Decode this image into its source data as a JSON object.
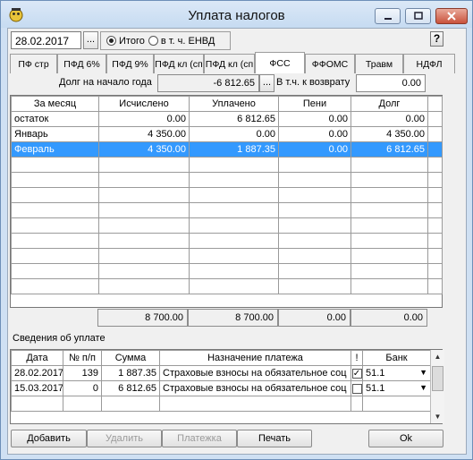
{
  "window": {
    "title": "Уплата налогов"
  },
  "toolbar": {
    "date": "28.02.2017",
    "dots": "...",
    "radio_total": "Итого",
    "radio_envd": "в т. ч. ЕНВД",
    "help": "?"
  },
  "tabs": [
    "ПФ стр",
    "ПФД 6%",
    "ПФД 9%",
    "ПФД кл (сп",
    "ПФД кл (сп",
    "ФСС",
    "ФФОМС",
    "Травм",
    "НДФЛ"
  ],
  "active_tab": "ФСС",
  "debt_info": {
    "debt_label": "Долг на начало года",
    "debt_value": "-6 812.65",
    "refund_label": "В т.ч. к возврату",
    "refund_value": "0.00"
  },
  "main_table": {
    "headers": [
      "За месяц",
      "Исчислено",
      "Уплачено",
      "Пени",
      "Долг"
    ],
    "rows": [
      [
        "остаток",
        "0.00",
        "6 812.65",
        "0.00",
        "0.00"
      ],
      [
        "Январь",
        "4 350.00",
        "0.00",
        "0.00",
        "4 350.00"
      ],
      [
        "Февраль",
        "4 350.00",
        "1 887.35",
        "0.00",
        "6 812.65"
      ]
    ],
    "selected_row": 2,
    "totals": [
      "8 700.00",
      "8 700.00",
      "0.00",
      "0.00"
    ]
  },
  "payments": {
    "section_label": "Сведения об уплате",
    "headers": [
      "Дата",
      "№ п/п",
      "Сумма",
      "Назначение платежа",
      "!",
      "Банк"
    ],
    "rows": [
      {
        "date": "28.02.2017",
        "num": "139",
        "sum": "1 887.35",
        "purpose": "Страховые взносы на обязательное соц",
        "checked": true,
        "bank": "51.1"
      },
      {
        "date": "15.03.2017",
        "num": "0",
        "sum": "6 812.65",
        "purpose": "Страховые взносы на обязательное соц",
        "checked": false,
        "bank": "51.1"
      }
    ]
  },
  "buttons": {
    "add": "Добавить",
    "delete": "Удалить",
    "payment_order": "Платежка",
    "print": "Печать",
    "ok": "Ok"
  }
}
